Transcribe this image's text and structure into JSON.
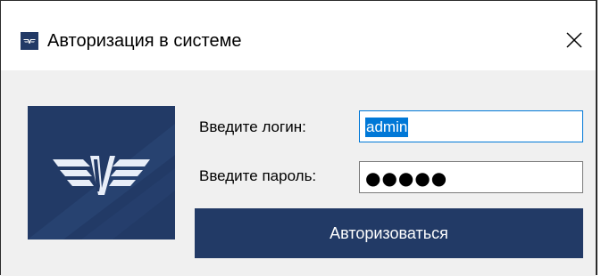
{
  "window": {
    "title": "Авторизация в системе",
    "close_glyph": "✕",
    "icons": {
      "app": "winged-logo-icon",
      "close": "close-icon"
    }
  },
  "form": {
    "login_label": "Введите логин:",
    "login_value": "admin",
    "password_label": "Введите пароль:",
    "password_value": "●●●●●",
    "submit_label": "Авторизоваться"
  },
  "colors": {
    "brand": "#223a66",
    "focus": "#0078d7",
    "background": "#f0f0f0"
  }
}
